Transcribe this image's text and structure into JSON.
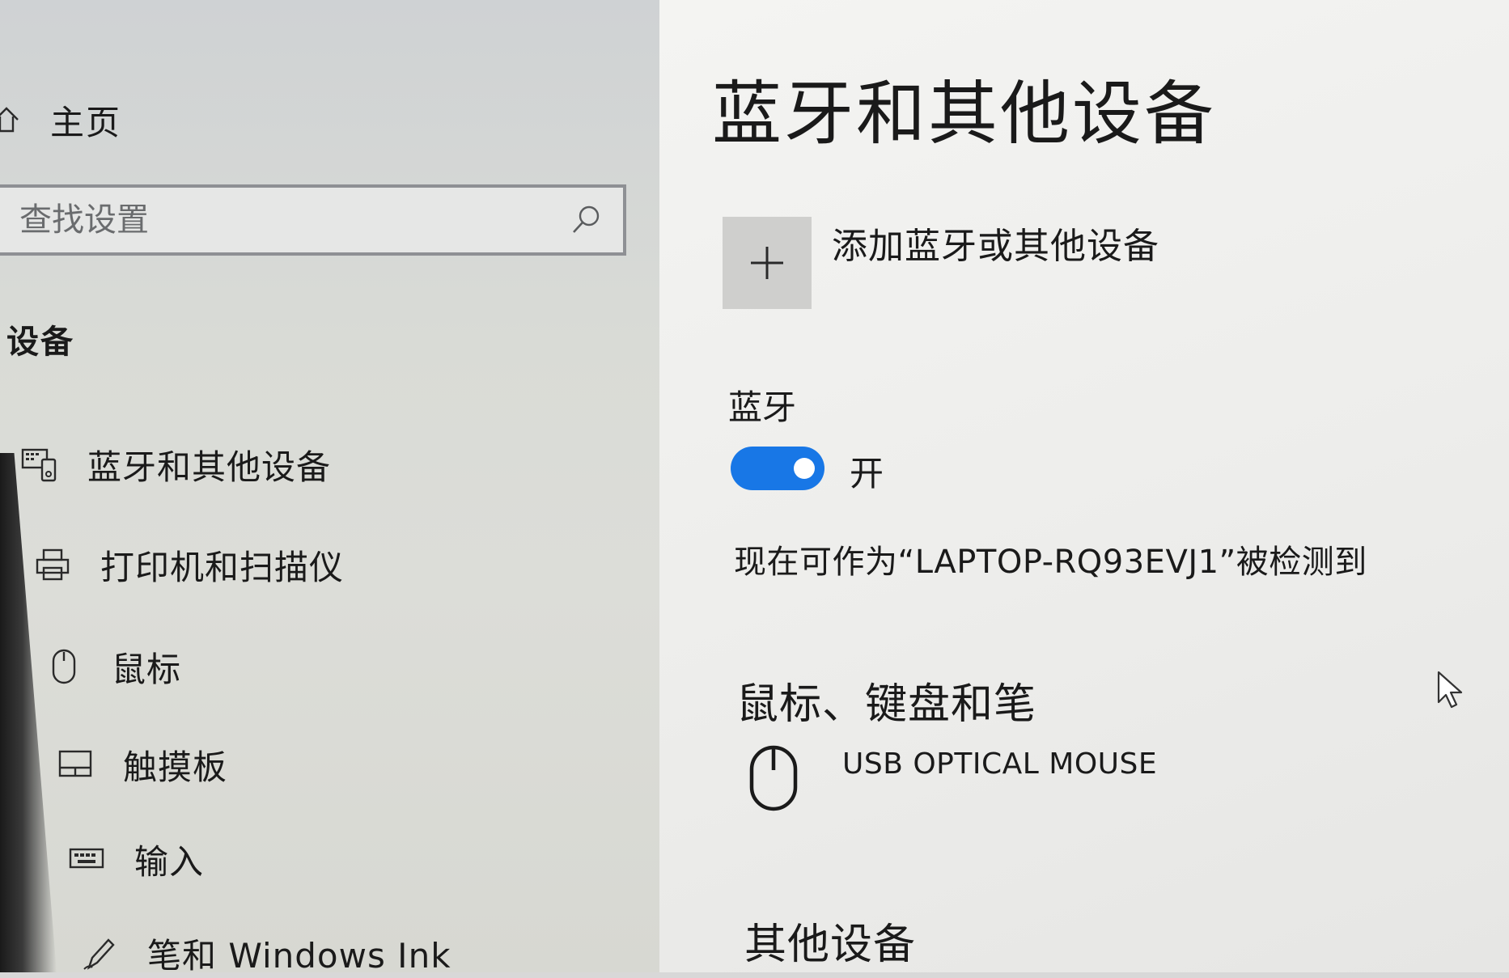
{
  "nav": {
    "home_label": "主页",
    "search_placeholder": "查找设置",
    "section_title": "设备",
    "items": [
      {
        "label": "蓝牙和其他设备",
        "icon": "bluetooth-devices-icon",
        "active": true
      },
      {
        "label": "打印机和扫描仪",
        "icon": "printer-icon"
      },
      {
        "label": "鼠标",
        "icon": "mouse-icon"
      },
      {
        "label": "触摸板",
        "icon": "touchpad-icon"
      },
      {
        "label": "输入",
        "icon": "keyboard-icon"
      },
      {
        "label": "笔和 Windows Ink",
        "icon": "pen-icon"
      }
    ]
  },
  "content": {
    "title": "蓝牙和其他设备",
    "add_device_label": "添加蓝牙或其他设备",
    "bluetooth": {
      "heading": "蓝牙",
      "state_label": "开",
      "enabled": true,
      "discoverable_text": "现在可作为“LAPTOP-RQ93EVJ1”被检测到"
    },
    "mouse_keyboard_pen": {
      "heading": "鼠标、键盘和笔",
      "devices": [
        {
          "name": "USB OPTICAL MOUSE",
          "icon": "mouse-icon"
        }
      ]
    },
    "other_devices": {
      "heading": "其他设备"
    }
  },
  "colors": {
    "accent": "#1877e6",
    "nav_background": "#d9dbd6",
    "content_background": "#f0f0ee"
  }
}
